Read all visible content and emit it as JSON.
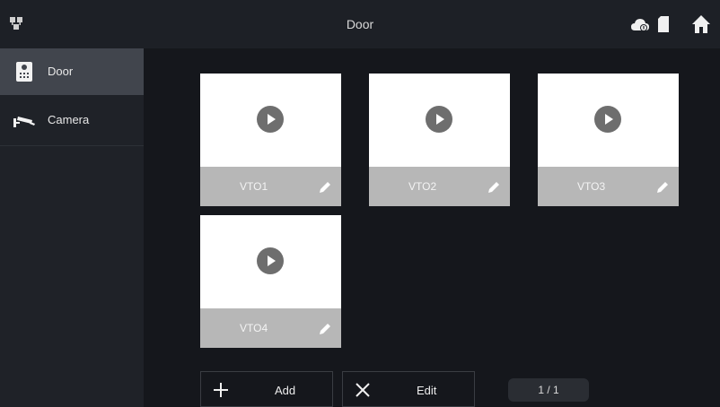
{
  "header": {
    "title": "Door",
    "icons": [
      "network-icon",
      "cloud-icon",
      "sd-card-icon",
      "home-icon"
    ]
  },
  "sidebar": {
    "items": [
      {
        "label": "Door",
        "icon": "door-station-icon",
        "active": true
      },
      {
        "label": "Camera",
        "icon": "camera-icon",
        "active": false
      }
    ]
  },
  "devices": [
    {
      "name": "VTO1"
    },
    {
      "name": "VTO2"
    },
    {
      "name": "VTO3"
    },
    {
      "name": "VTO4"
    }
  ],
  "actions": {
    "add_label": "Add",
    "edit_label": "Edit"
  },
  "pagination": {
    "text": "1 / 1"
  },
  "colors": {
    "background": "#15171c",
    "topbar": "#1d2026",
    "sidebar": "#1f2228",
    "sidebar_active": "#41454d",
    "card_bar": "#b7b7b7",
    "play_button": "#6e6e6e"
  }
}
